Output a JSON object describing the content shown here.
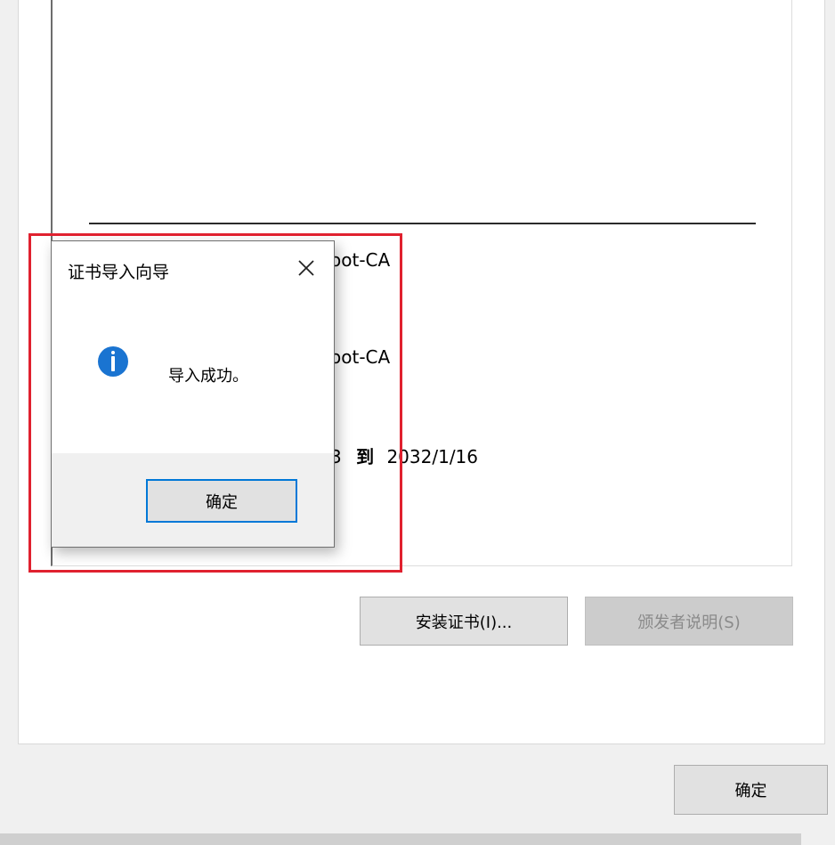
{
  "certificate": {
    "issued_to_partial": "oot-CA",
    "issued_by_partial": "oot-CA",
    "validity_partial_from": "3",
    "validity_to_word": "到",
    "validity_to_date": "2032/1/16"
  },
  "buttons": {
    "install_cert": "安装证书(I)...",
    "issuer_statement": "颁发者说明(S)",
    "ok": "确定"
  },
  "dialog": {
    "title": "证书导入向导",
    "message": "导入成功。",
    "ok": "确定",
    "close_symbol": "✕"
  },
  "colors": {
    "highlight_border": "#e0212f",
    "focus_border": "#0078d7",
    "info_icon": "#1a74d1"
  },
  "icons": {
    "info": "info-icon",
    "close": "close-icon"
  }
}
